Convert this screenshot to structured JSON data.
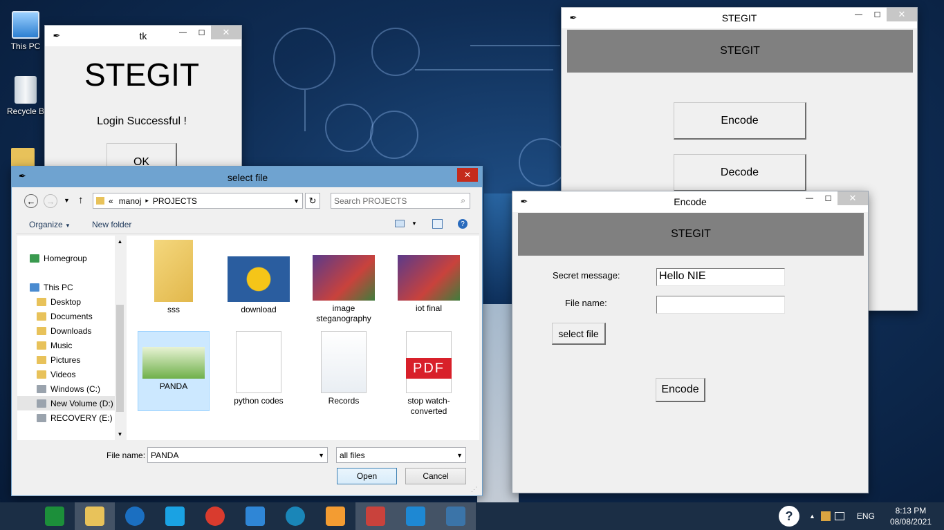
{
  "desktop": {
    "icons": [
      {
        "label": "This PC"
      },
      {
        "label": "Recycle B"
      }
    ]
  },
  "login_window": {
    "title": "tk",
    "app_name": "STEGIT",
    "message": "Login Successful !",
    "ok_label": "OK"
  },
  "stegit_window": {
    "title": "STEGIT",
    "header": "STEGIT",
    "encode_label": "Encode",
    "decode_label": "Decode"
  },
  "encode_window": {
    "title": "Encode",
    "header": "STEGIT",
    "secret_label": "Secret message:",
    "secret_value": "Hello NIE",
    "filename_label": "File name:",
    "filename_value": "",
    "select_file_label": "select file",
    "encode_label": "Encode"
  },
  "file_dialog": {
    "title": "select file",
    "breadcrumb": {
      "overflow": "«",
      "parts": [
        "manoj",
        "PROJECTS"
      ]
    },
    "search_placeholder": "Search PROJECTS",
    "toolbar": {
      "organize": "Organize",
      "new_folder": "New folder"
    },
    "nav": [
      {
        "label": "Homegroup",
        "icon": "homegroup-icon"
      },
      {
        "label": "This PC",
        "icon": "computer-icon"
      },
      {
        "label": "Desktop",
        "icon": "folder-icon"
      },
      {
        "label": "Documents",
        "icon": "folder-icon"
      },
      {
        "label": "Downloads",
        "icon": "folder-icon"
      },
      {
        "label": "Music",
        "icon": "folder-icon"
      },
      {
        "label": "Pictures",
        "icon": "folder-icon"
      },
      {
        "label": "Videos",
        "icon": "folder-icon"
      },
      {
        "label": "Windows (C:)",
        "icon": "drive-icon"
      },
      {
        "label": "New Volume (D:)",
        "icon": "drive-icon"
      },
      {
        "label": "RECOVERY (E:)",
        "icon": "drive-icon"
      }
    ],
    "files": [
      {
        "name": "sss",
        "type": "folder"
      },
      {
        "name": "download",
        "type": "image"
      },
      {
        "name": "image steganography",
        "type": "pptx"
      },
      {
        "name": "iot final",
        "type": "pptx"
      },
      {
        "name": "PANDA",
        "type": "image",
        "selected": true
      },
      {
        "name": "python codes",
        "type": "vscode"
      },
      {
        "name": "Records",
        "type": "settings"
      },
      {
        "name": "stop watch-converted",
        "type": "pdf",
        "badge": "PDF"
      }
    ],
    "filename_label": "File name:",
    "filename_value": "PANDA",
    "filter_value": "all files",
    "open_label": "Open",
    "cancel_label": "Cancel"
  },
  "taskbar": {
    "apps": [
      "start",
      "store",
      "file-explorer",
      "hp",
      "rocket",
      "chrome",
      "internet-explorer",
      "edge",
      "media",
      "powerpoint",
      "vscode",
      "python"
    ],
    "tray": {
      "lang": "ENG",
      "time": "8:13 PM",
      "date": "08/08/2021"
    }
  }
}
